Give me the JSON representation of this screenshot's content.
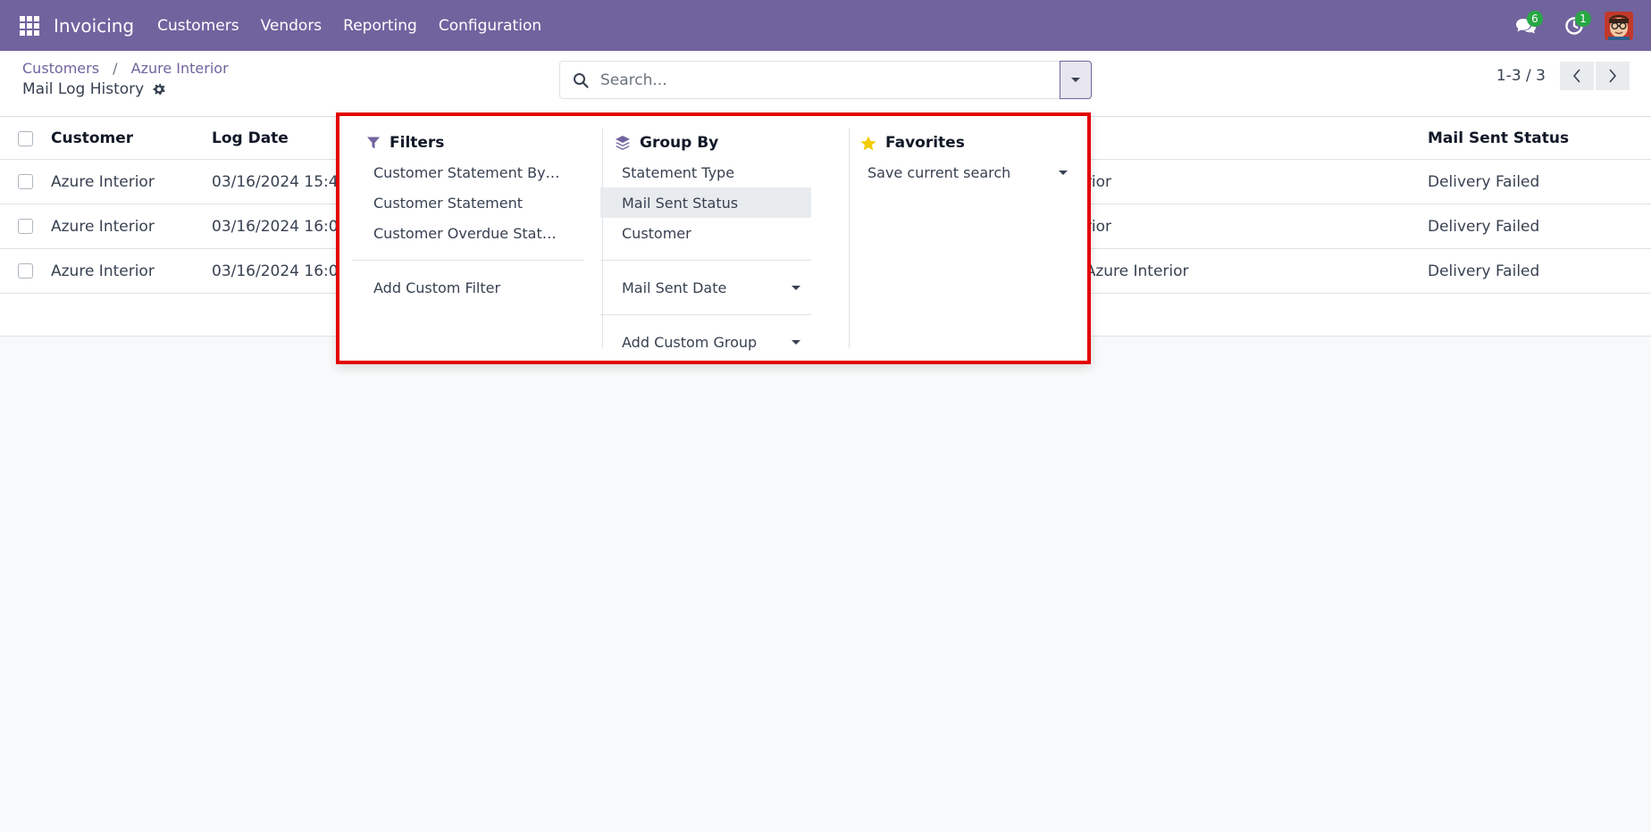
{
  "navbar": {
    "app_name": "Invoicing",
    "menu": [
      "Customers",
      "Vendors",
      "Reporting",
      "Configuration"
    ],
    "messages_count": "6",
    "activities_count": "1"
  },
  "breadcrumb": {
    "root": "Customers",
    "parent": "Azure Interior",
    "separator": "/"
  },
  "page_title": "Mail Log History",
  "search": {
    "placeholder": "Search..."
  },
  "pager": {
    "value": "1-3 / 3"
  },
  "table": {
    "columns": {
      "customer": "Customer",
      "log_date": "Log Date",
      "status": "Mail Sent Status"
    },
    "rows": [
      {
        "customer": "Azure Interior",
        "log_date": "03/16/2024 15:4",
        "name": "nterior",
        "status": "Delivery Failed"
      },
      {
        "customer": "Azure Interior",
        "log_date": "03/16/2024 16:0",
        "name": "nterior",
        "status": "Delivery Failed"
      },
      {
        "customer": "Azure Interior",
        "log_date": "03/16/2024 16:0",
        "name": "n - Azure Interior",
        "status": "Delivery Failed"
      }
    ]
  },
  "dropdown": {
    "filters": {
      "title": "Filters",
      "items": [
        "Customer Statement By…",
        "Customer Statement",
        "Customer Overdue Stat…"
      ],
      "custom": "Add Custom Filter"
    },
    "groupby": {
      "title": "Group By",
      "items": [
        "Statement Type",
        "Mail Sent Status",
        "Customer"
      ],
      "date_option": "Mail Sent Date",
      "custom": "Add Custom Group"
    },
    "favorites": {
      "title": "Favorites",
      "save": "Save current search"
    }
  },
  "colors": {
    "navbar": "#71639e",
    "highlight_border": "#e30000",
    "star": "#f3cc00"
  }
}
